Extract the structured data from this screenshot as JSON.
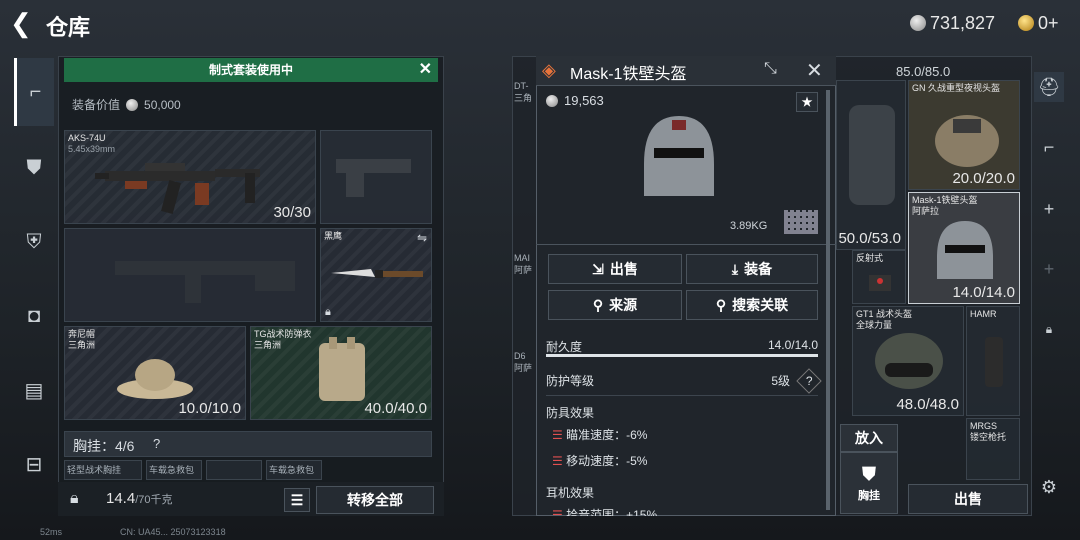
{
  "header": {
    "title": "仓库",
    "silver": "731,827",
    "gold": "0+"
  },
  "left": {
    "banner": "制式套装使用中",
    "value_label": "装备价值",
    "value": "50,000",
    "weapon1": {
      "name": "AKS-74U",
      "caliber": "5.45x39mm",
      "count": "30/30"
    },
    "knife": {
      "name": "黑鹰"
    },
    "hat": {
      "name": "奔尼帽",
      "origin": "三角洲",
      "count": "10.0/10.0"
    },
    "vest": {
      "name": "TG战术防弹衣",
      "origin": "三角洲",
      "count": "40.0/40.0"
    },
    "chest": {
      "label": "胸挂：4/6",
      "help": "?"
    },
    "chest_items": [
      "轻型战术胸挂",
      "车载急救包",
      "",
      "车载急救包"
    ],
    "weight": "14.4",
    "weight_max": "/70千克",
    "transfer_all": "转移全部"
  },
  "dialog": {
    "title": "Mask-1铁壁头盔",
    "price": "19,563",
    "weight": "3.89KG",
    "sell": "出售",
    "equip": "装备",
    "source": "来源",
    "search": "搜索关联",
    "durability_label": "耐久度",
    "durability": "14.0/14.0",
    "protection_label": "防护等级",
    "protection": "5级",
    "help": "?",
    "armor_effect": "防具效果",
    "effects": [
      "瞄准速度：-6%",
      "移动速度：-5%"
    ],
    "headset_effect": "耳机效果",
    "headset_partial": "拾音范围：+15%"
  },
  "right": {
    "top_value": "85.0/85.0",
    "nv": {
      "name": "GN 久战重型夜视头盔",
      "count": "20.0/20.0"
    },
    "vest_count": "50.0/53.0",
    "mask": {
      "name": "Mask-1铁壁头盔",
      "origin": "阿萨拉",
      "count": "14.0/14.0"
    },
    "reflex": "反射式",
    "gt1": {
      "name": "GT1 战术头盔",
      "origin": "全球力量",
      "count": "48.0/48.0"
    },
    "hamr": "HAMR",
    "mrgs": {
      "name": "MRGS",
      "origin": "镂空枪托"
    },
    "side_labels": [
      "DT-",
      "三角",
      "MAI",
      "阿萨",
      "D6",
      "阿萨"
    ],
    "mid_value": "14",
    "put_in": "放入",
    "chest_btn": "胸挂",
    "sell": "出售"
  },
  "footer": {
    "ping": "52ms",
    "id": "CN: UA45... 25073123318"
  }
}
